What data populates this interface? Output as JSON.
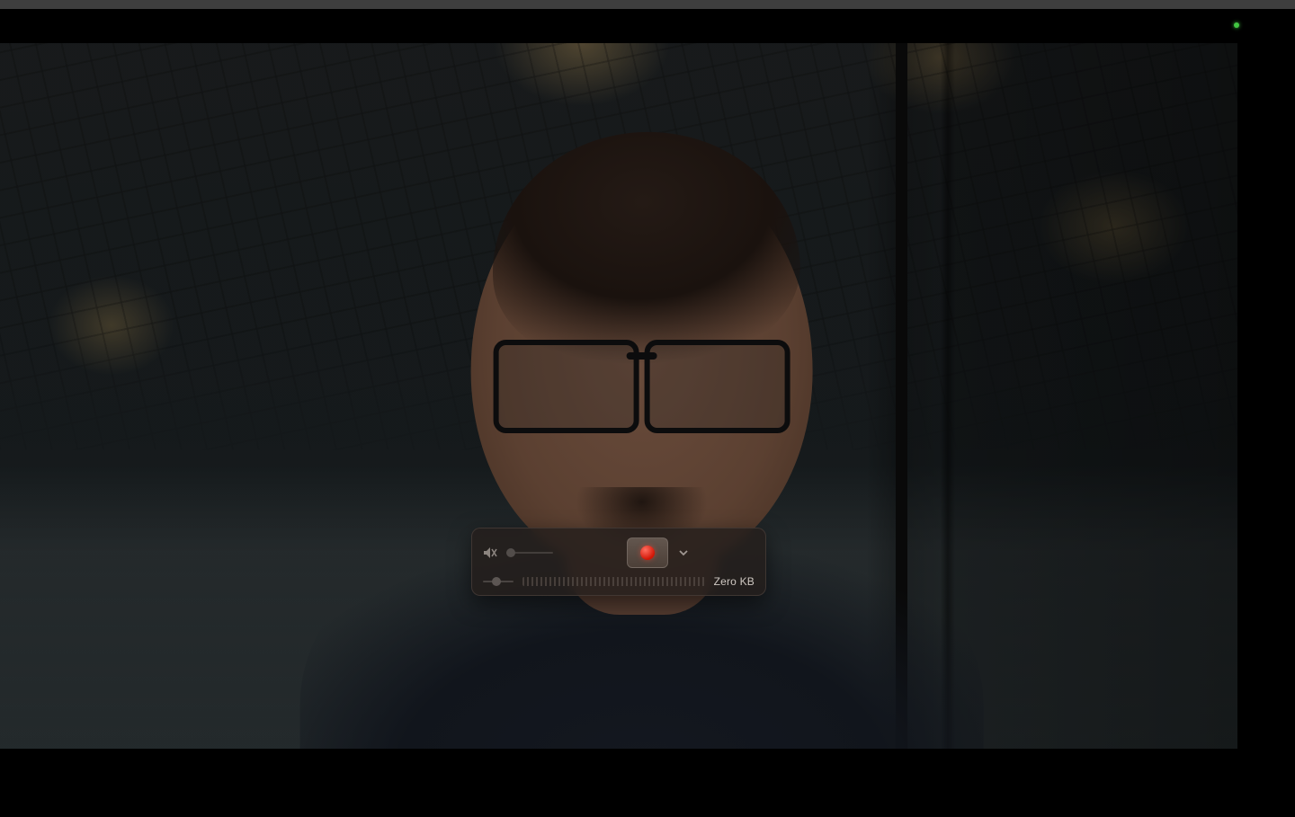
{
  "camera": {
    "led_on": true
  },
  "controls": {
    "record_button_title": "Record",
    "options_button_title": "Options",
    "volume_button_title": "Volume",
    "file_size_label": "Zero KB"
  }
}
